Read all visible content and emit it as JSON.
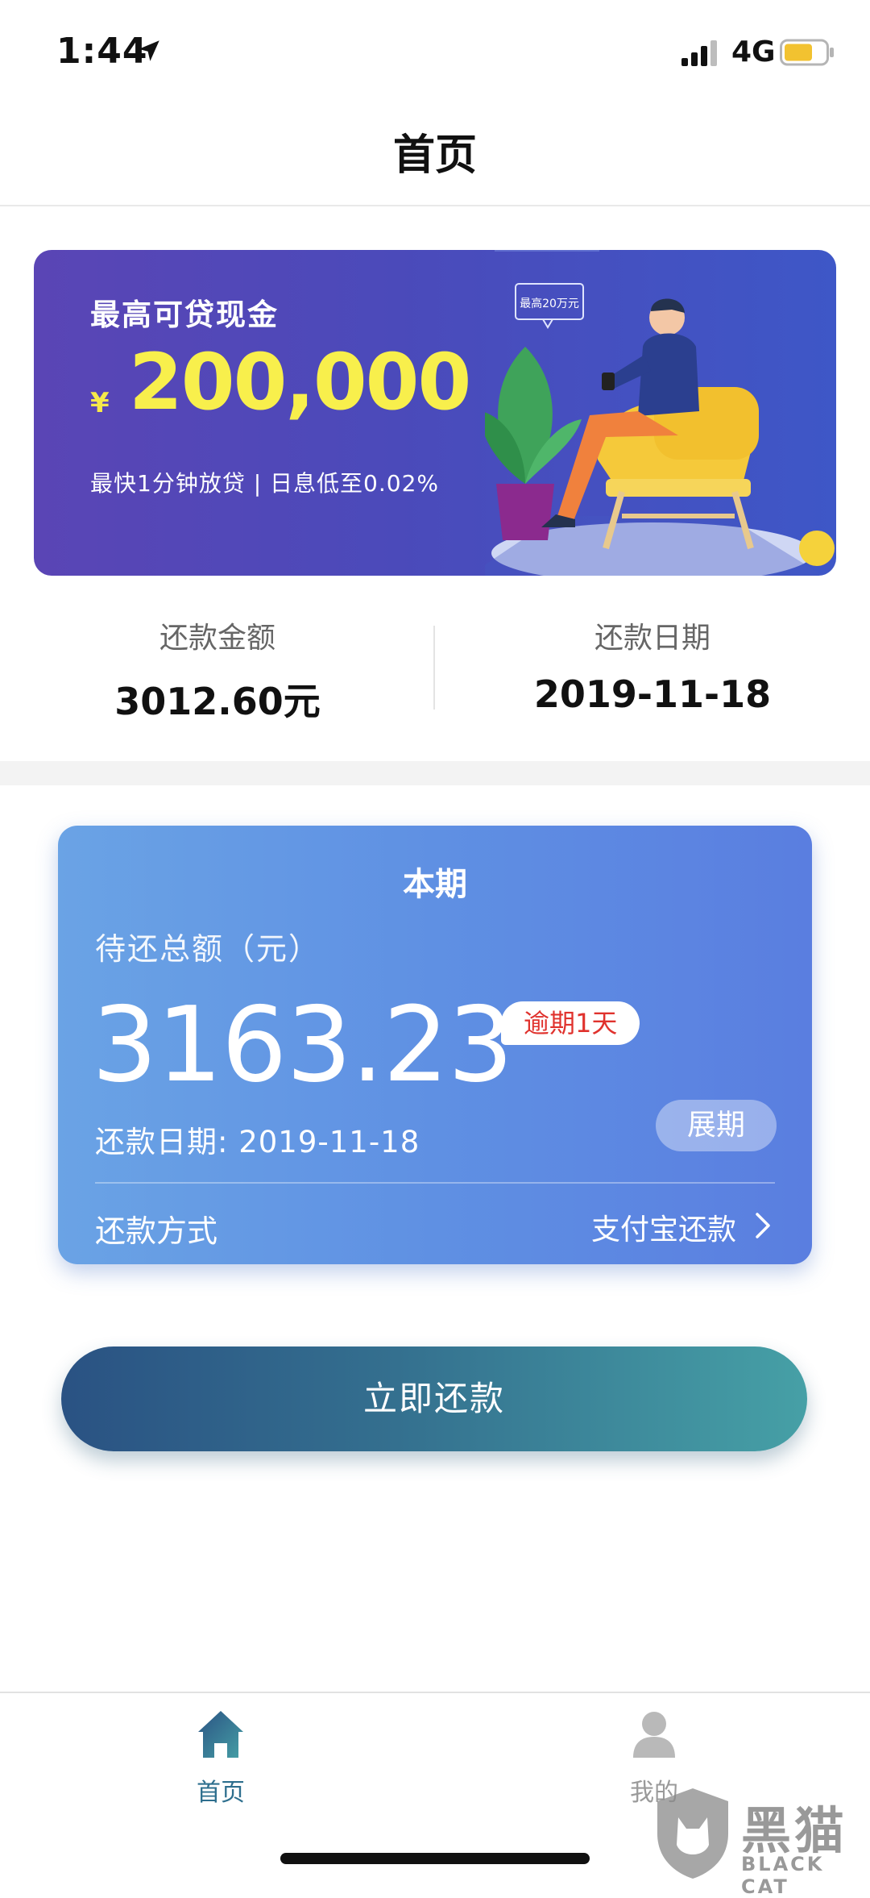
{
  "status_bar": {
    "time": "1:44",
    "network": "4G",
    "battery_color": "#f2c230"
  },
  "header": {
    "title": "首页"
  },
  "banner": {
    "title": "最高可贷现金",
    "currency": "¥",
    "amount": "200,000",
    "subtitle": "最快1分钟放贷 | 日息低至0.02%",
    "bubble_text": "最高20万元",
    "coin_symbol": "¥"
  },
  "summary": {
    "amount_label": "还款金额",
    "amount_value": "3012.60元",
    "date_label": "还款日期",
    "date_value": "2019-11-18"
  },
  "current_period": {
    "title": "本期",
    "due_label": "待还总额（元）",
    "due_amount": "3163.23",
    "overdue_badge": "逾期1天",
    "due_date": "还款日期: 2019-11-18",
    "extend_label": "展期",
    "pay_method_label": "还款方式",
    "pay_method_value": "支付宝还款"
  },
  "actions": {
    "pay_now_label": "立即还款"
  },
  "tab_bar": {
    "items": [
      {
        "label": "首页",
        "icon": "home-icon",
        "active": true,
        "color": "#2e6f8e"
      },
      {
        "label": "我的",
        "icon": "user-icon",
        "active": false,
        "color": "#9a9a9a"
      }
    ]
  },
  "watermark": {
    "cn": "黑猫",
    "en": "BLACK CAT"
  },
  "colors": {
    "banner_accent": "#f8ef4c",
    "overdue_red": "#e0322d",
    "button_start": "#2a5283",
    "button_end": "#46a0a6"
  }
}
